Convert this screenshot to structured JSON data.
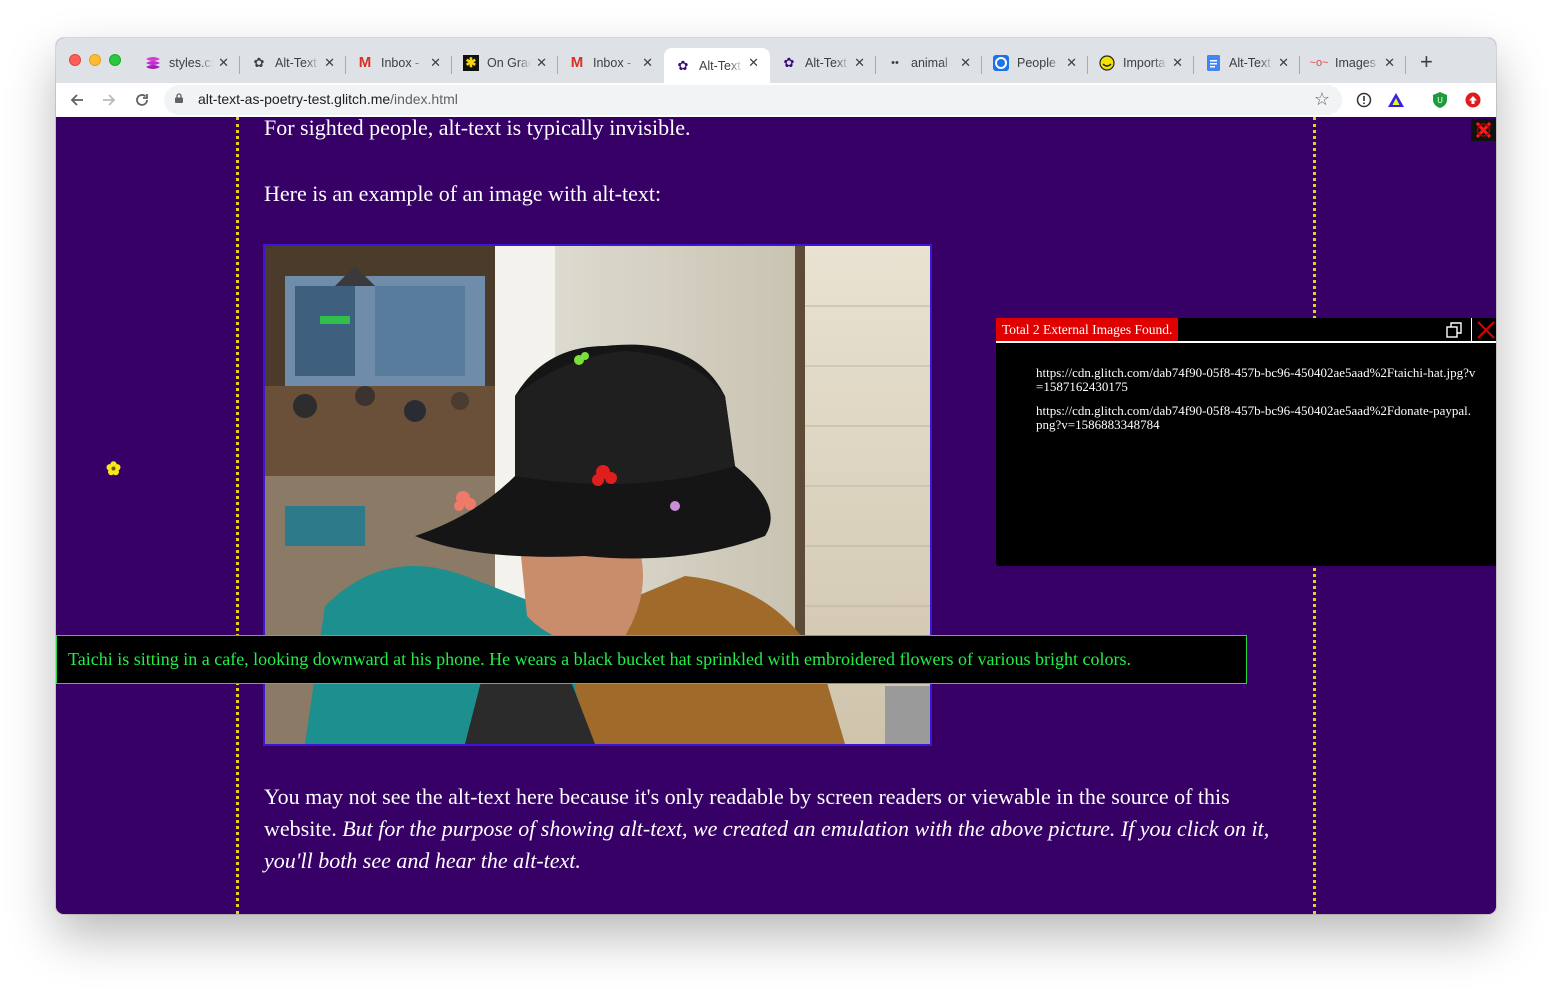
{
  "tabs": [
    {
      "title": "styles.css",
      "icon": "styles-icon"
    },
    {
      "title": "Alt-Text",
      "icon": "glitch-flower-icon"
    },
    {
      "title": "Inbox - ",
      "icon": "gmail-icon"
    },
    {
      "title": "On Grace",
      "icon": "asterisk-icon"
    },
    {
      "title": "Inbox - ",
      "icon": "gmail-icon"
    },
    {
      "title": "Alt-Text",
      "icon": "glitch-flower-icon",
      "active": true
    },
    {
      "title": "Alt-Text",
      "icon": "glitch-flower-icon"
    },
    {
      "title": "animal",
      "icon": "eyes-icon"
    },
    {
      "title": "People",
      "icon": "circle-icon"
    },
    {
      "title": "Importa",
      "icon": "smiley-icon"
    },
    {
      "title": "Alt-Text",
      "icon": "docs-icon"
    },
    {
      "title": "Images",
      "icon": "images-icon"
    }
  ],
  "toolbar": {
    "url_host": "alt-text-as-poetry-test.glitch.me",
    "url_path": "/index.html"
  },
  "page": {
    "line1": "For sighted people, alt-text is typically invisible.",
    "line2": "Here is an example of an image with alt-text:",
    "alt_text": "Taichi is sitting in a cafe, looking downward at his phone. He wears a black bucket hat sprinkled with embroidered flowers of various bright colors.",
    "para_normal": "You may not see the alt-text here because it's only readable by screen readers or viewable in the source of this website. ",
    "para_italic": "But for the purpose of showing alt-text, we created an emulation with the above picture. If you click on it, you'll both see and hear the alt-text."
  },
  "panel": {
    "title": "Total 2 External Images Found.",
    "urls": [
      "https://cdn.glitch.com/dab74f90-05f8-457b-bc96-450402ae5aad%2Ftaichi-hat.jpg?v=1587162430175",
      "https://cdn.glitch.com/dab74f90-05f8-457b-bc96-450402ae5aad%2Fdonate-paypal.png?v=1586883348784"
    ]
  },
  "colors": {
    "page_bg": "#360066",
    "dash": "#e6d11b",
    "alt_green": "#22ef48",
    "panel_red": "#e00000"
  }
}
